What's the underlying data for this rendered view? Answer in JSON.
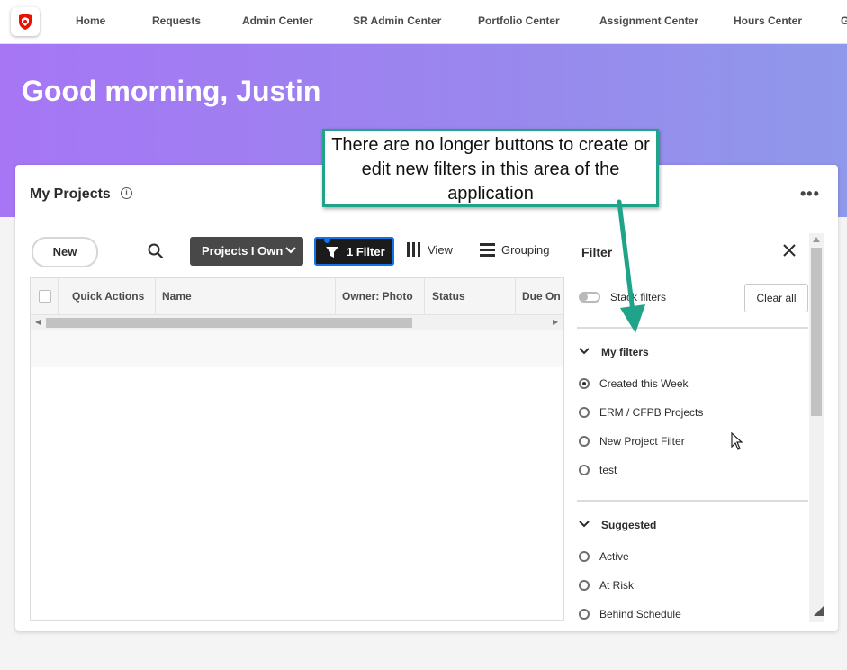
{
  "nav": {
    "items": [
      "Home",
      "Requests",
      "Admin Center",
      "SR Admin Center",
      "Portfolio Center",
      "Assignment Center",
      "Hours Center",
      "G"
    ]
  },
  "hero": {
    "greeting": "Good morning, Justin"
  },
  "card": {
    "title": "My Projects",
    "info_icon": "i",
    "more_icon": "•••"
  },
  "toolbar": {
    "new_label": "New",
    "projects_label": "Projects I Own",
    "filter_label": "1 Filter",
    "view_label": "View",
    "grouping_label": "Grouping"
  },
  "table": {
    "columns": [
      "Quick Actions",
      "Name",
      "Owner: Photo",
      "Status",
      "Due On"
    ]
  },
  "filter_panel": {
    "title": "Filter",
    "toggle_label": "Stack filters",
    "clear_label": "Clear all",
    "my_filters": {
      "title": "My filters",
      "items": [
        {
          "label": "Created this Week",
          "selected": true
        },
        {
          "label": "ERM / CFPB Projects",
          "selected": false
        },
        {
          "label": "New Project Filter",
          "selected": false
        },
        {
          "label": "test",
          "selected": false
        }
      ]
    },
    "suggested": {
      "title": "Suggested",
      "items": [
        {
          "label": "Active",
          "selected": false
        },
        {
          "label": "At Risk",
          "selected": false
        },
        {
          "label": "Behind Schedule",
          "selected": false
        }
      ]
    }
  },
  "callout": {
    "text": "There are no longer buttons to create or edit new filters in this area of the application"
  },
  "colors": {
    "accent": "#1473e6",
    "callout_border": "#1fa389",
    "hero_start": "#a676f5",
    "hero_end": "#8f98ea",
    "logo_red": "#eb1000"
  }
}
